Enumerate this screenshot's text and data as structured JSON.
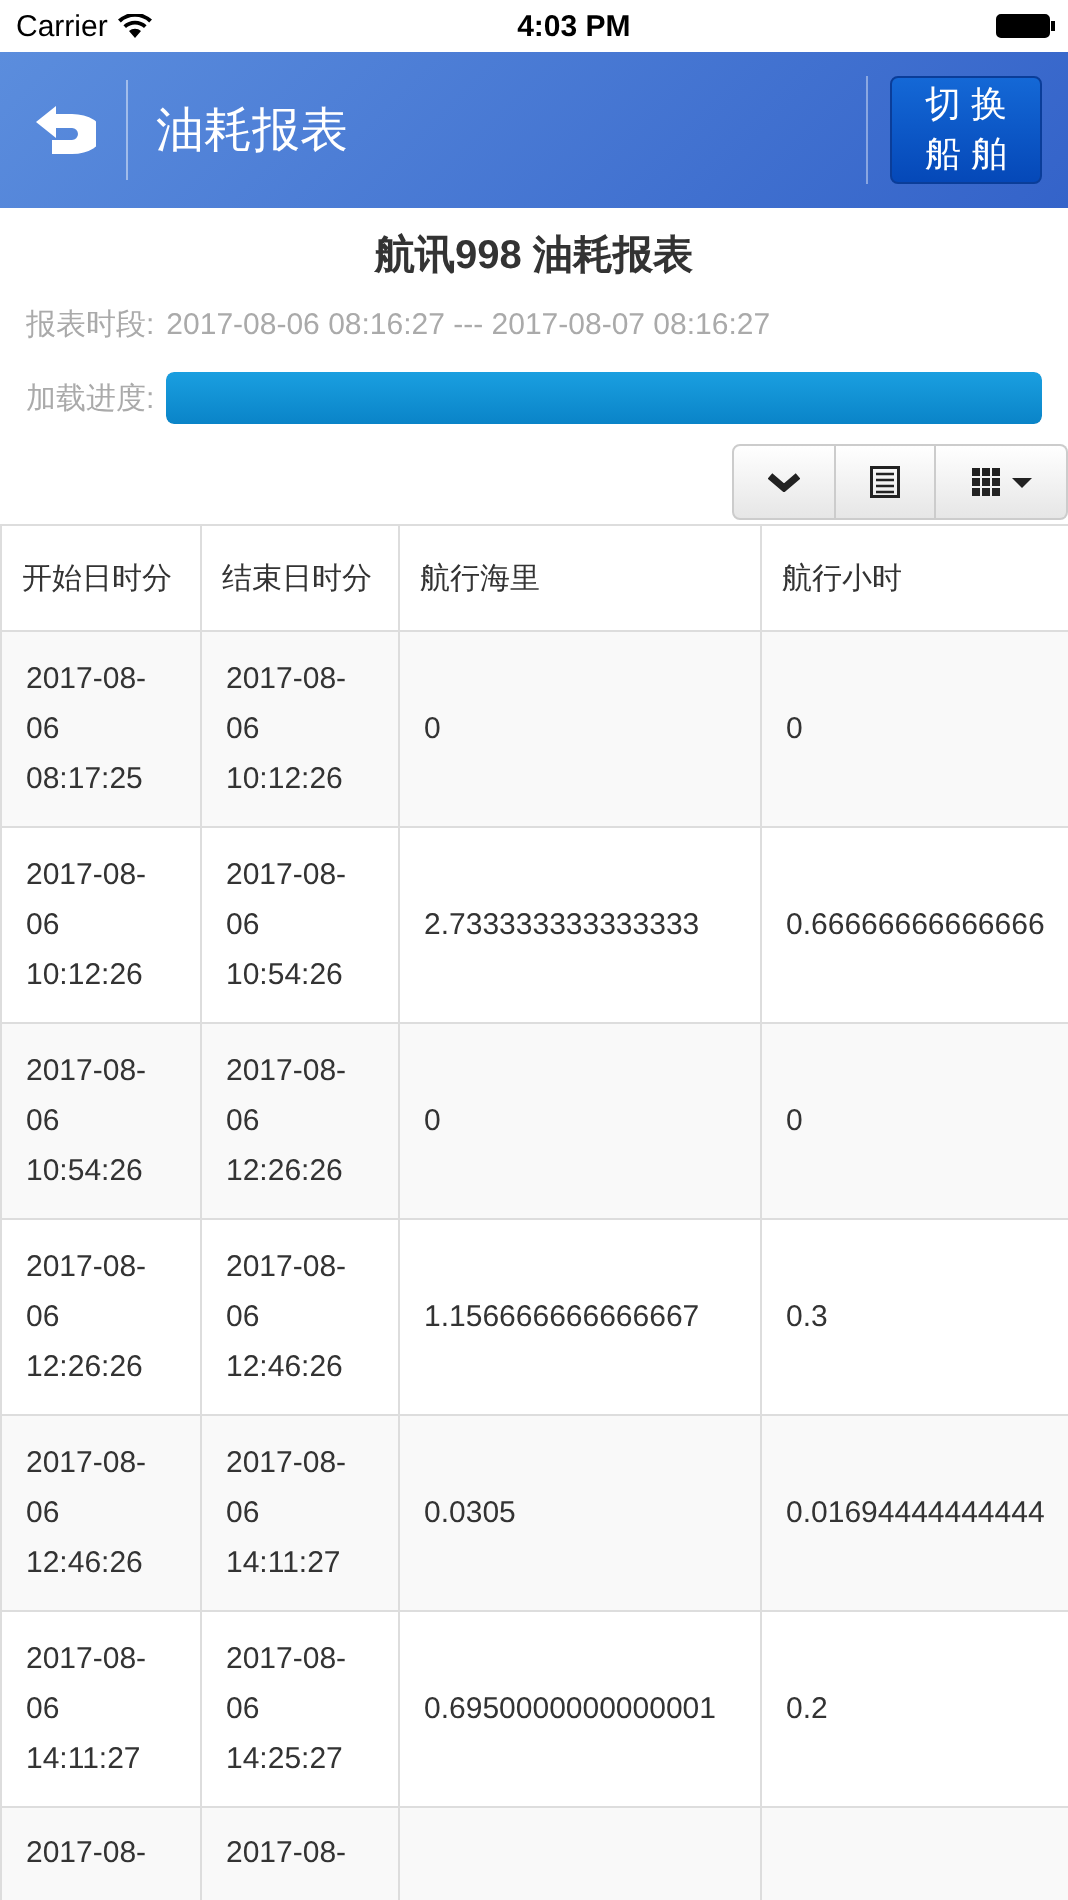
{
  "status_bar": {
    "carrier": "Carrier",
    "time": "4:03 PM"
  },
  "nav_bar": {
    "title": "油耗报表",
    "switch_button": {
      "line_1": "切 换",
      "line_2": "船 舶"
    }
  },
  "report": {
    "title": "航讯998 油耗报表",
    "period_label": "报表时段:",
    "period_value": "2017-08-06 08:16:27 --- 2017-08-07 08:16:27",
    "progress_label": "加载进度:",
    "progress": {
      "level": 1
    }
  },
  "table": {
    "columns": [
      "开始日时分",
      "结束日时分",
      "航行海里",
      "航行小时"
    ],
    "rows": [
      [
        "2017-08-06 08:17:25",
        "2017-08-06 10:12:26",
        "0",
        "0"
      ],
      [
        "2017-08-06 10:12:26",
        "2017-08-06 10:54:26",
        "2.733333333333333",
        "0.66666666666666"
      ],
      [
        "2017-08-06 10:54:26",
        "2017-08-06 12:26:26",
        "0",
        "0"
      ],
      [
        "2017-08-06 12:26:26",
        "2017-08-06 12:46:26",
        "1.156666666666667",
        "0.3"
      ],
      [
        "2017-08-06 12:46:26",
        "2017-08-06 14:11:27",
        "0.0305",
        "0.01694444444444"
      ],
      [
        "2017-08-06 14:11:27",
        "2017-08-06 14:25:27",
        "0.6950000000000001",
        "0.2"
      ],
      [
        "2017-08-",
        "2017-08-"
      ]
    ]
  }
}
